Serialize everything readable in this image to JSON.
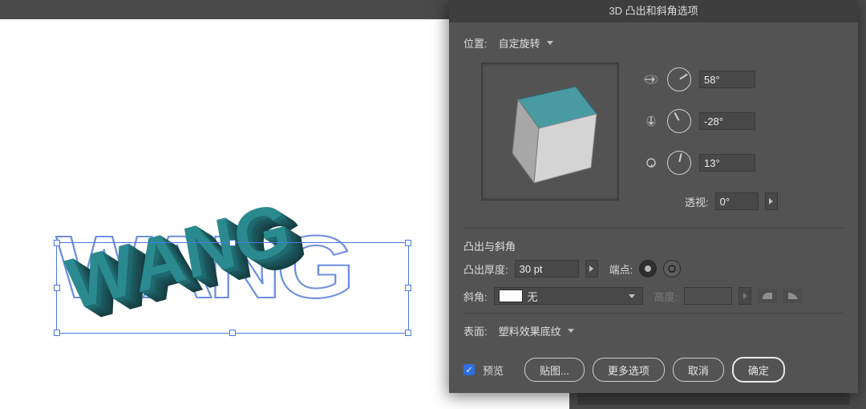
{
  "canvas": {
    "text": "WANG"
  },
  "dialog": {
    "title": "3D 凸出和斜角选项",
    "position_label": "位置:",
    "position_value": "自定旋转",
    "rotation": {
      "x": "58°",
      "y": "-28°",
      "z": "13°"
    },
    "perspective_label": "透视:",
    "perspective_value": "0°",
    "extrude_section": "凸出与斜角",
    "extrude_depth_label": "凸出厚度:",
    "extrude_depth_value": "30 pt",
    "cap_label": "端点:",
    "bevel_label": "斜角:",
    "bevel_value": "无",
    "bevel_height_label": "高度:",
    "surface_label": "表面:",
    "surface_value": "塑料效果底纹",
    "preview_checkbox": "预览",
    "map_art_button": "贴图...",
    "more_options_button": "更多选项",
    "cancel_button": "取消",
    "ok_button": "确定"
  }
}
